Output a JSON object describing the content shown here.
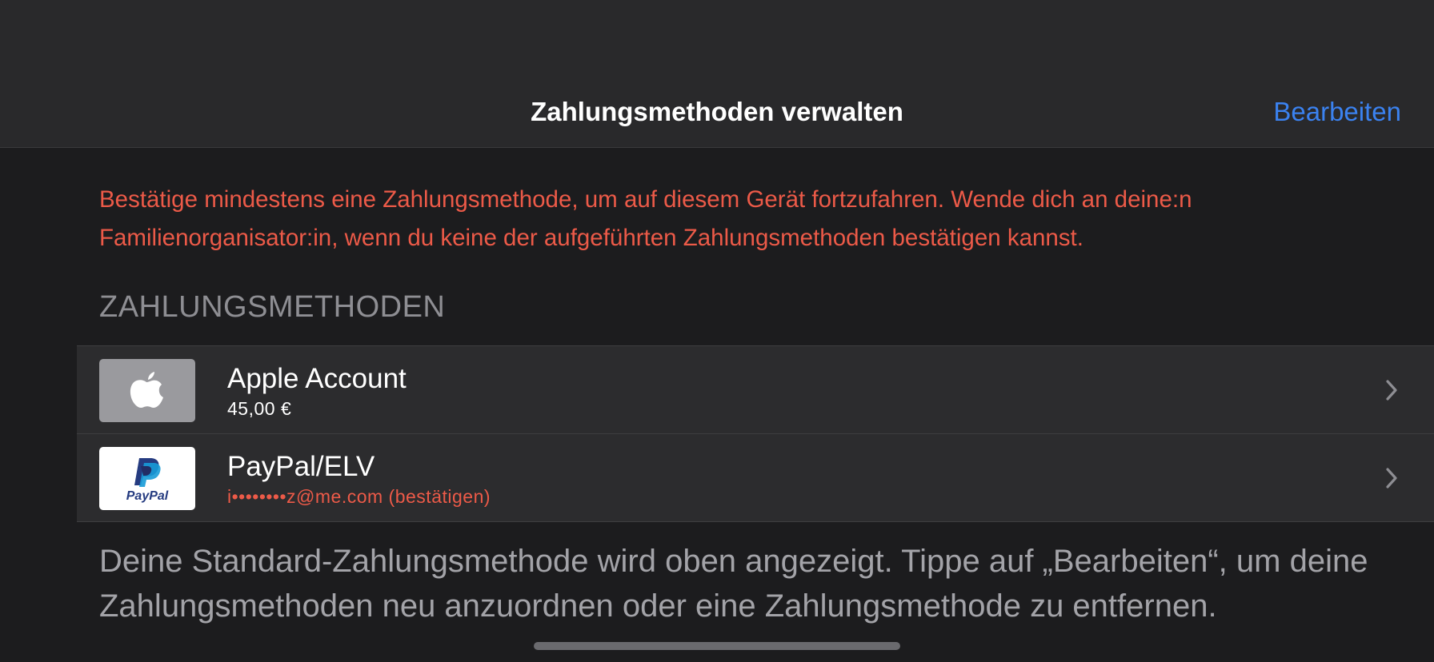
{
  "header": {
    "title": "Zahlungsmethoden verwalten",
    "edit_label": "Bearbeiten"
  },
  "warning_text": "Bestätige mindestens eine Zahlungsmethode, um auf diesem Gerät fortzufahren. Wende dich an deine:n Familienorganisator:in, wenn du keine der aufgeführten Zahlungsmethoden bestätigen kannst.",
  "section_header": "ZAHLUNGSMETHODEN",
  "payment_methods": [
    {
      "title": "Apple Account",
      "subtitle": "45,00 €",
      "icon": "apple-logo-icon"
    },
    {
      "title": "PayPal/ELV",
      "subtitle": "i••••••••z@me.com (bestätigen)",
      "icon": "paypal-logo-icon",
      "logo_text": "PayPal"
    }
  ],
  "footer_text": "Deine Standard-Zahlungsmethode wird oben angezeigt. Tippe auf „Bearbeiten“, um deine Zahlungsmethoden neu anzuordnen oder eine Zahlungsmethode zu entfernen.",
  "colors": {
    "accent": "#3b82f0",
    "warning": "#ec5a48",
    "background": "#1c1c1e",
    "cell": "#2c2c2e"
  }
}
